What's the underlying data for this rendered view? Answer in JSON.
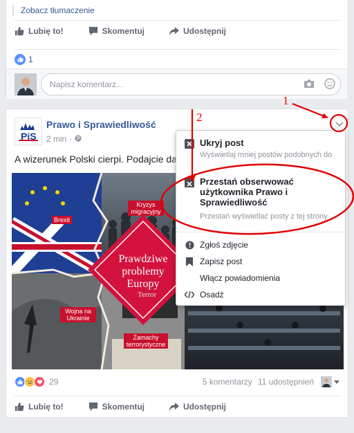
{
  "post1": {
    "see_translation": "Zobacz tłumaczenie",
    "actions": {
      "like": "Lubię to!",
      "comment": "Skomentuj",
      "share": "Udostępnij"
    },
    "reaction_count": "1",
    "comment_placeholder": "Napisz komentarz..."
  },
  "post2": {
    "page_name": "Prawo i Sprawiedliwość",
    "time": "2 min",
    "text": "A wizerunek Polski cierpi. Podajcie da",
    "logo_text": "PiS",
    "image": {
      "center_label": "Prawdziwe problemy Europy",
      "tiles": [
        "Brexit",
        "Kryzys migracyjny",
        "Wojna na Ukrainie",
        "Zamachy terrorystyczne",
        "Terror"
      ]
    },
    "reaction_count": "29",
    "comments_count": "5 komentarzy",
    "shares_count": "11 udostępnień",
    "actions": {
      "like": "Lubię to!",
      "comment": "Skomentuj",
      "share": "Udostępnij"
    }
  },
  "menu": {
    "hide": {
      "title": "Ukryj post",
      "subtitle": "Wyświetlaj mniej postów podobnych do tego"
    },
    "unfollow": {
      "title": "Przestań obserwować użytkownika Prawo i Sprawiedliwość",
      "subtitle": "Przestań wyświetlać posty z tej strony"
    },
    "items": [
      "Zgłoś zdjęcie",
      "Zapisz post",
      "Włącz powiadomienia",
      "Osadź"
    ]
  },
  "annotations": {
    "one": "1",
    "two": "2"
  },
  "colors": {
    "fb_blue": "#365899",
    "annotation_red": "#e00000",
    "like_blue": "#5890ff"
  }
}
